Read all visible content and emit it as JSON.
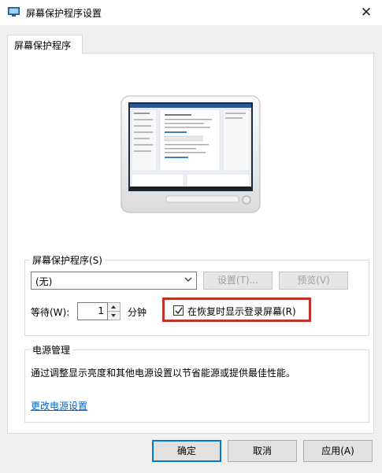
{
  "window": {
    "title": "屏幕保护程序设置",
    "close_symbol": "✕",
    "app_icon": "monitor-icon"
  },
  "tab": {
    "label": "屏幕保护程序"
  },
  "screensaver_group": {
    "label": "屏幕保护程序(S)",
    "selected_value": "(无)",
    "settings_button": "设置(T)...",
    "preview_button": "预览(V)",
    "wait_label": "等待(W):",
    "wait_value": "1",
    "minute_label": "分钟",
    "logon_checkbox_label": "在恢复时显示登录屏幕(R)",
    "logon_checked": true,
    "highlight_color": "#c0332b"
  },
  "power_group": {
    "label": "电源管理",
    "description": "通过调整显示亮度和其他电源设置以节省能源或提供最佳性能。",
    "link": "更改电源设置",
    "link_color": "#0066cc"
  },
  "footer": {
    "ok": "确定",
    "cancel": "取消",
    "apply": "应用(A)"
  }
}
